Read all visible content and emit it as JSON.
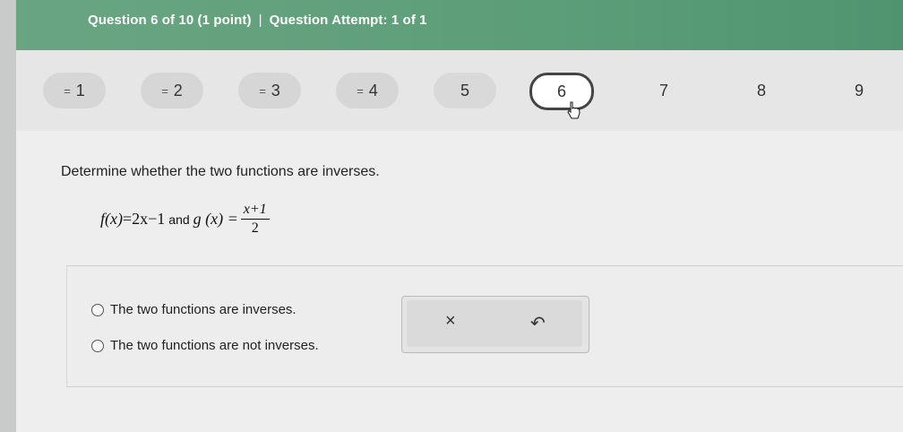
{
  "header": {
    "question": "Question 6 of 10 (1 point)",
    "separator": "|",
    "attempt": "Question Attempt: 1 of 1",
    "color": "#5c9e78"
  },
  "nav": {
    "questions": [
      {
        "label": "1",
        "state": "answered",
        "marker": "="
      },
      {
        "label": "2",
        "state": "answered",
        "marker": "="
      },
      {
        "label": "3",
        "state": "answered",
        "marker": "="
      },
      {
        "label": "4",
        "state": "answered",
        "marker": "="
      },
      {
        "label": "5",
        "state": "unanswered"
      },
      {
        "label": "6",
        "state": "current"
      },
      {
        "label": "7",
        "state": "unanswered"
      },
      {
        "label": "8",
        "state": "unanswered"
      },
      {
        "label": "9",
        "state": "unanswered"
      }
    ]
  },
  "question": {
    "prompt": "Determine whether the two functions are inverses.",
    "f_lhs": "f(x)",
    "f_rhs": "=2x−1",
    "connector": "and",
    "g_lhs": "g (x) =",
    "g_num": "x+1",
    "g_den": "2"
  },
  "answers": {
    "options": [
      "The two functions are inverses.",
      "The two functions are not inverses."
    ]
  },
  "tools": {
    "clear_icon": "×",
    "undo_icon": "↶"
  }
}
